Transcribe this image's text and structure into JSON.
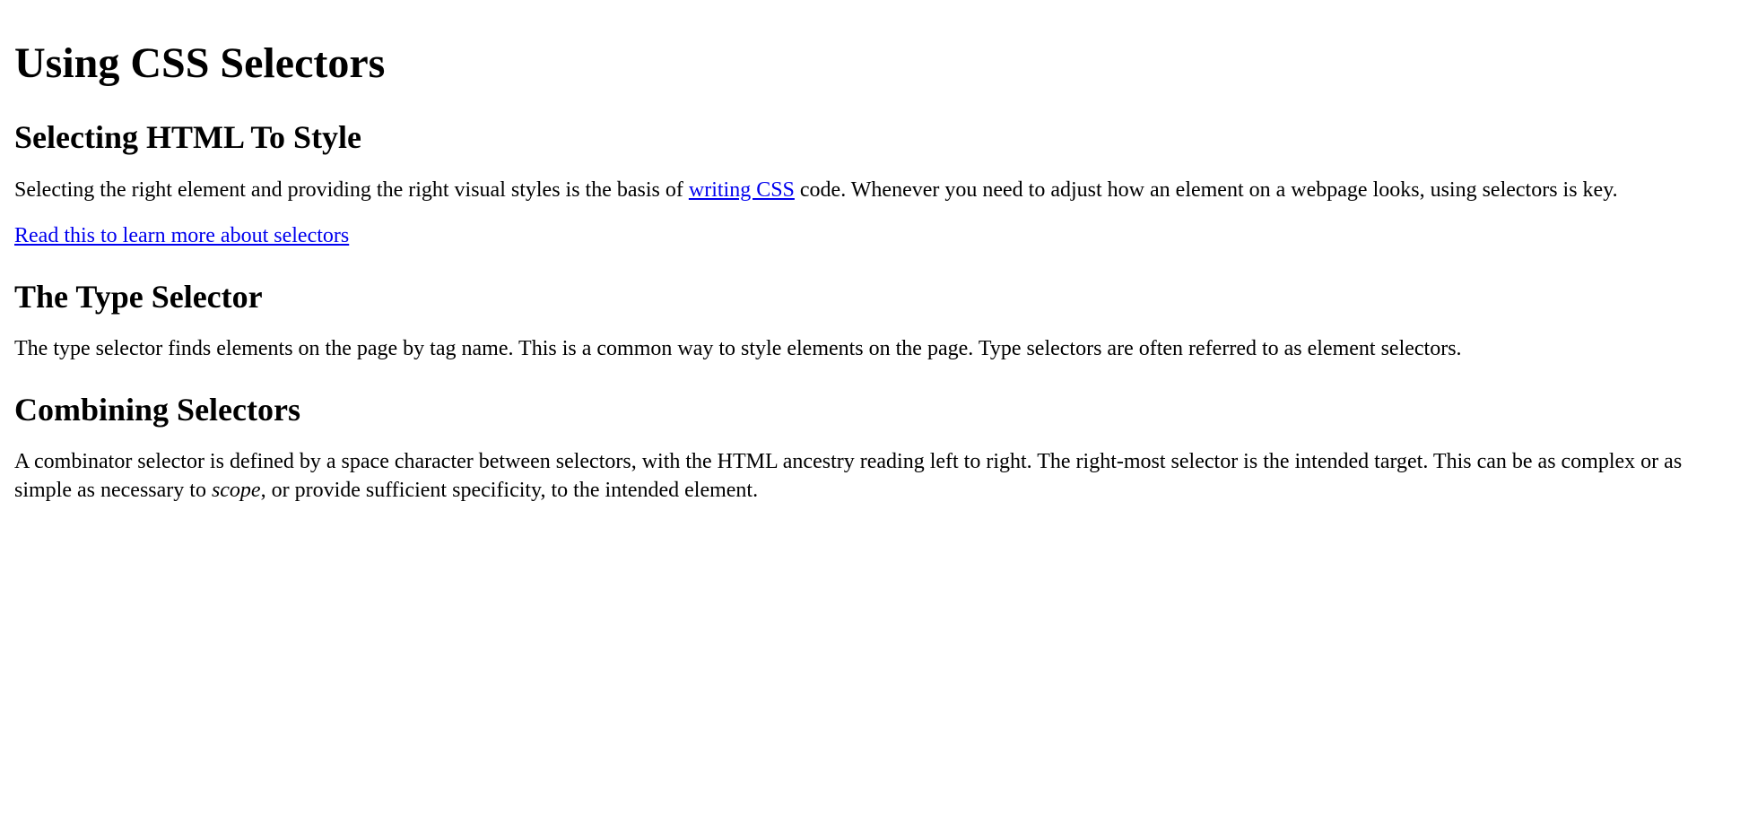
{
  "page_title": "Using CSS Selectors",
  "sections": {
    "selecting": {
      "heading": "Selecting HTML To Style",
      "para_before": "Selecting the right element and providing the right visual styles is the basis of ",
      "link_text": "writing CSS",
      "para_after": " code. Whenever you need to adjust how an element on a webpage looks, using selectors is key.",
      "more_link": "Read this to learn more about selectors"
    },
    "type_selector": {
      "heading": "The Type Selector",
      "para": "The type selector finds elements on the page by tag name. This is a common way to style elements on the page. Type selectors are often referred to as element selectors."
    },
    "combining": {
      "heading": "Combining Selectors",
      "para_before": "A combinator selector is defined by a space character between selectors, with the HTML ancestry reading left to right. The right-most selector is the intended target. This can be as complex or as simple as necessary to ",
      "em_text": "scope",
      "para_after": ", or provide sufficient specificity, to the intended element."
    }
  }
}
